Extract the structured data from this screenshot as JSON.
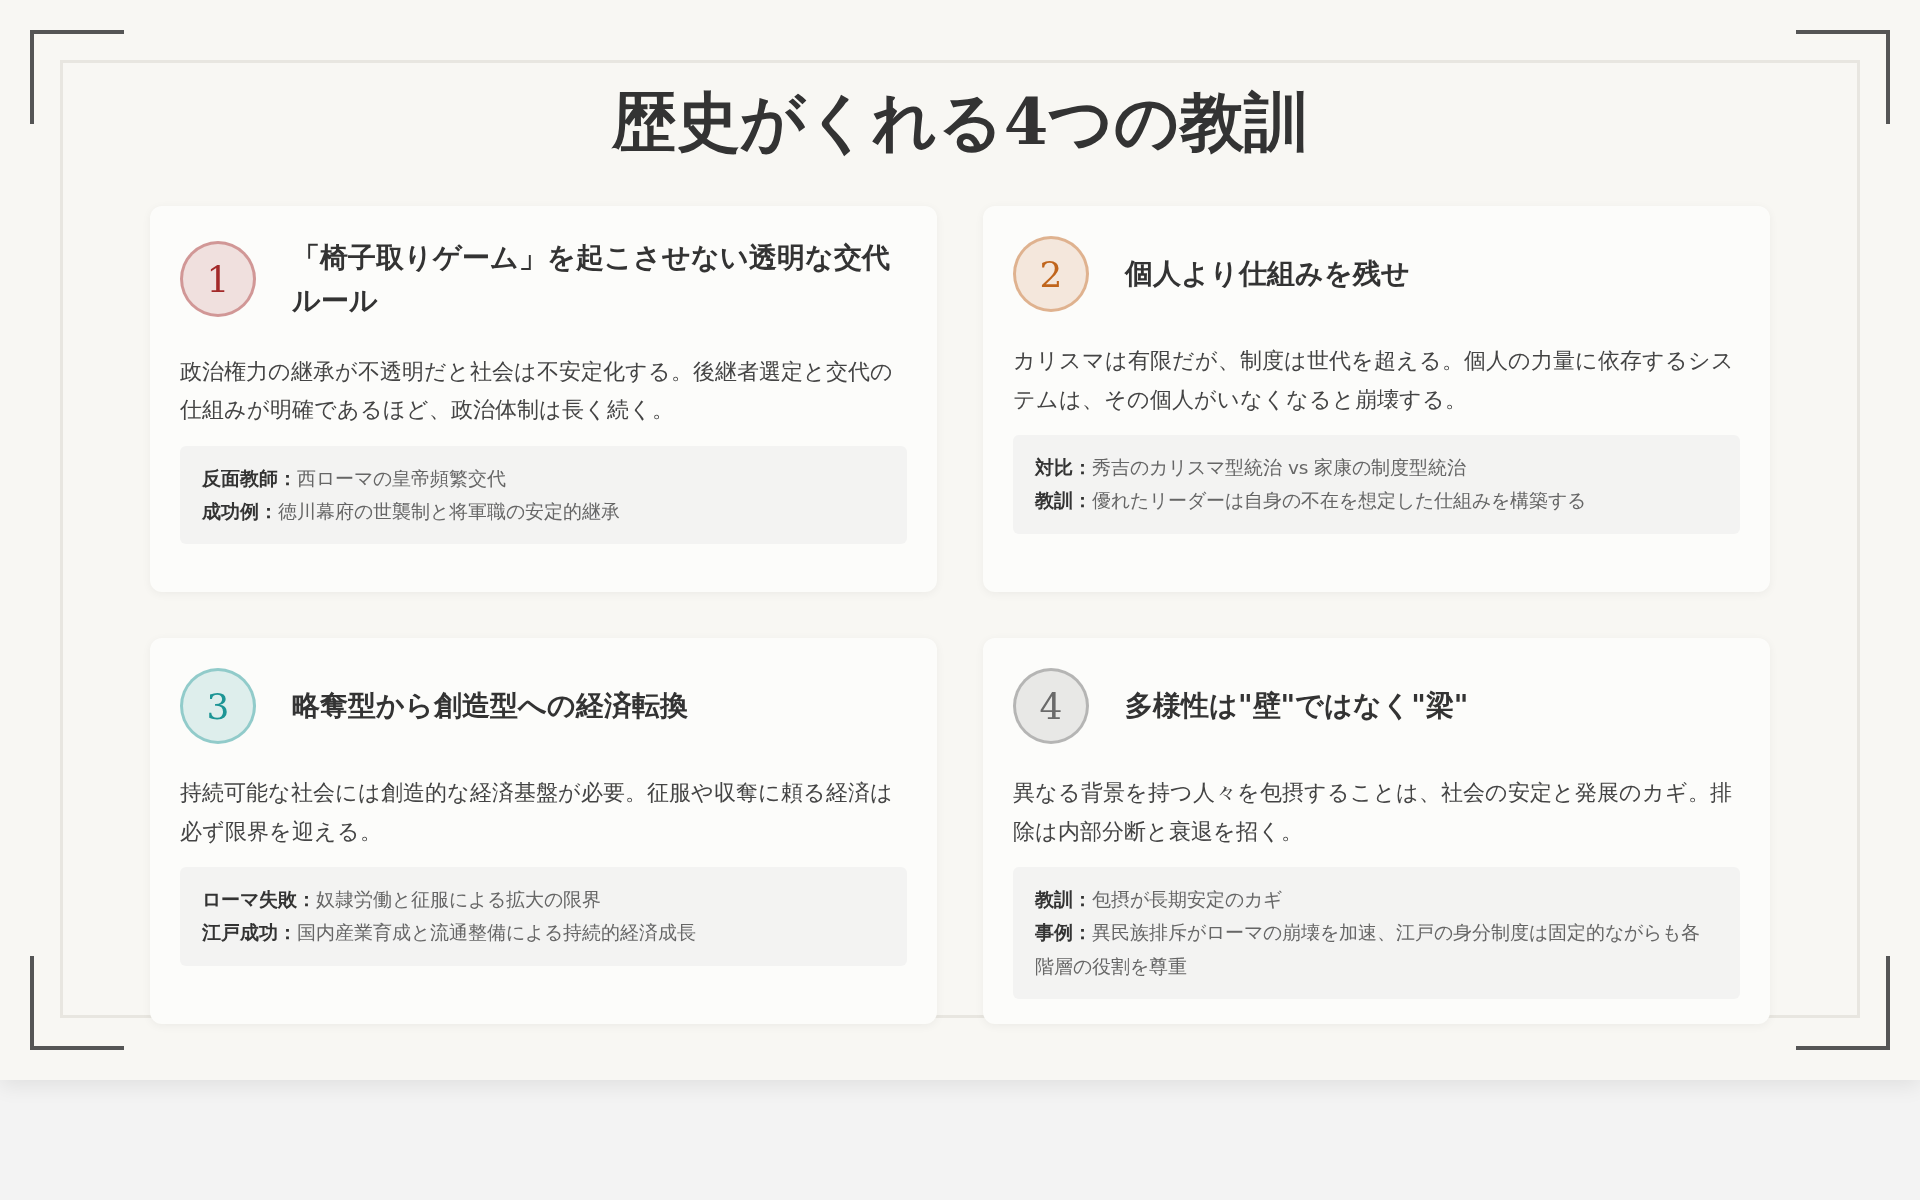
{
  "title": "歴史がくれる4つの教訓",
  "lessons": [
    {
      "number": "1",
      "color": "#a32a2a",
      "heading": "「椅子取りゲーム」を起こさせない透明な交代ルール",
      "body": "政治権力の継承が不透明だと社会は不安定化する。後継者選定と交代の仕組みが明確であるほど、政治体制は長く続く。",
      "notes": [
        "**反面教師：**西ローマの皇帝頻繁交代",
        "**成功例：**徳川幕府の世襲制と将軍職の安定的継承"
      ]
    },
    {
      "number": "2",
      "color": "#c0651c",
      "heading": "個人より仕組みを残せ",
      "body": "カリスマは有限だが、制度は世代を超える。個人の力量に依存するシステムは、その個人がいなくなると崩壊する。",
      "notes": [
        "**対比：**秀吉のカリスマ型統治 vs 家康の制度型統治",
        "**教訓：**優れたリーダーは自身の不在を想定した仕組みを構築する"
      ]
    },
    {
      "number": "3",
      "color": "#1d9595",
      "heading": "略奪型から創造型への経済転換",
      "body": "持続可能な社会には創造的な経済基盤が必要。征服や収奪に頼る経済は必ず限界を迎える。",
      "notes": [
        "**ローマ失敗：**奴隷労働と征服による拡大の限界",
        "**江戸成功：**国内産業育成と流通整備による持続的経済成長"
      ]
    },
    {
      "number": "4",
      "color": "#6a6a6a",
      "heading": "多様性は\"壁\"ではなく\"梁\"",
      "body": "異なる背景を持つ人々を包摂することは、社会の安定と発展のカギ。排除は内部分断と衰退を招く。",
      "notes": [
        "**教訓：**包摂が長期安定のカギ",
        "**事例：**異民族排斥がローマの崩壊を加速、江戸の身分制度は固定的ながらも各階層の役割を尊重"
      ]
    }
  ]
}
